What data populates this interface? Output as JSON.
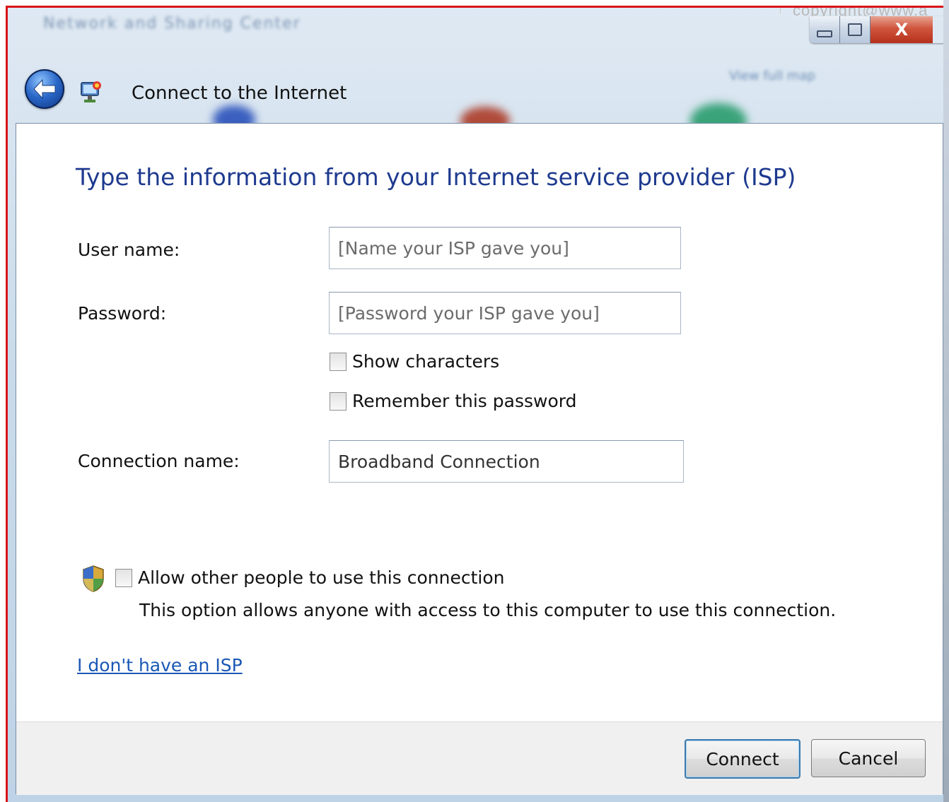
{
  "watermark": "copyright@www.a",
  "window": {
    "title": "Connect to the Internet",
    "background_title": "Network and Sharing Center",
    "background_right": "View full map",
    "controls": {
      "close": "X"
    }
  },
  "form": {
    "heading": "Type the information from your Internet service provider (ISP)",
    "username": {
      "label": "User name:",
      "placeholder": "[Name your ISP gave you]",
      "value": ""
    },
    "password": {
      "label": "Password:",
      "placeholder": "[Password your ISP gave you]",
      "value": ""
    },
    "show_characters": {
      "label": "Show characters",
      "checked": false
    },
    "remember_password": {
      "label": "Remember this password",
      "checked": false
    },
    "connection_name": {
      "label": "Connection name:",
      "value": "Broadband Connection"
    },
    "allow_others": {
      "label": "Allow other people to use this connection",
      "description": "This option allows anyone with access to this computer to use this connection.",
      "checked": false
    },
    "no_isp_link": "I don't have an ISP"
  },
  "footer": {
    "connect_label": "Connect",
    "cancel_label": "Cancel"
  },
  "colors": {
    "heading": "#1e3a8f",
    "link": "#1a57b5",
    "frame_border": "#d8141a"
  }
}
